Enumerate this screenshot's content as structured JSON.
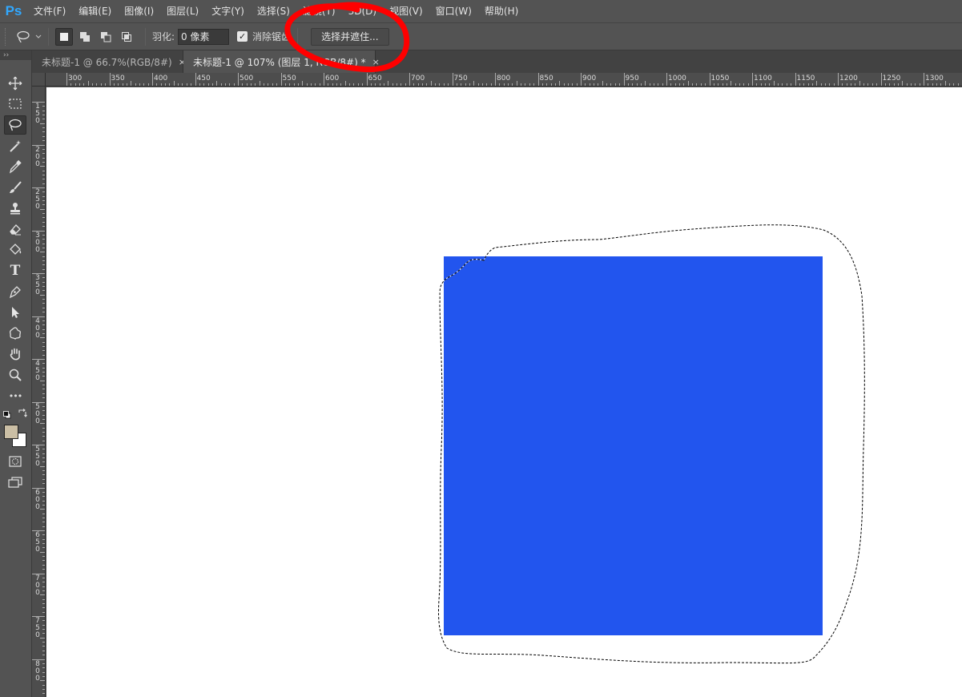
{
  "app": {
    "logo": "Ps"
  },
  "menu": [
    "文件(F)",
    "编辑(E)",
    "图像(I)",
    "图层(L)",
    "文字(Y)",
    "选择(S)",
    "滤镜(T)",
    "3D(D)",
    "视图(V)",
    "窗口(W)",
    "帮助(H)"
  ],
  "options": {
    "feather_label": "羽化:",
    "feather_value": "0 像素",
    "antialias_label": "消除锯齿",
    "antialias_checked": true,
    "select_mask_button": "选择并遮住..."
  },
  "tabs": [
    {
      "label": "未标题-1 @ 66.7%(RGB/8#)",
      "close": "×",
      "active": false
    },
    {
      "label": "未标题-1 @ 107% (图层 1, RGB/8#) *",
      "close": "×",
      "active": true
    }
  ],
  "ruler": {
    "top_labels": [
      "300",
      "350",
      "400",
      "450",
      "500",
      "550",
      "600",
      "650",
      "700",
      "750",
      "800",
      "850",
      "900",
      "950",
      "1000",
      "1050",
      "1100",
      "1150",
      "1200",
      "1250",
      "1300"
    ],
    "left_labels": [
      "150",
      "200",
      "250",
      "300",
      "350",
      "400",
      "450",
      "500",
      "550",
      "600",
      "650",
      "700",
      "750",
      "800"
    ]
  },
  "toolbar": {
    "collapse_glyph": "››",
    "tools": [
      "move-tool",
      "marquee-tool",
      "lasso-tool",
      "magic-wand-tool",
      "eyedropper-tool",
      "brush-tool",
      "clone-stamp-tool",
      "eraser-tool",
      "paint-bucket-tool",
      "type-tool",
      "pen-tool",
      "path-selection-tool",
      "custom-shape-tool",
      "hand-tool",
      "zoom-tool",
      "more-tools",
      "quick-mask-tool",
      "screen-mode-tool"
    ],
    "active_tool": "lasso-tool",
    "type_glyph": "T",
    "more_glyph": "•••"
  },
  "colors": {
    "foreground": "#cbbfa5",
    "background": "#ffffff",
    "shape_fill": "#2255ee",
    "annotation": "#ff0000"
  }
}
